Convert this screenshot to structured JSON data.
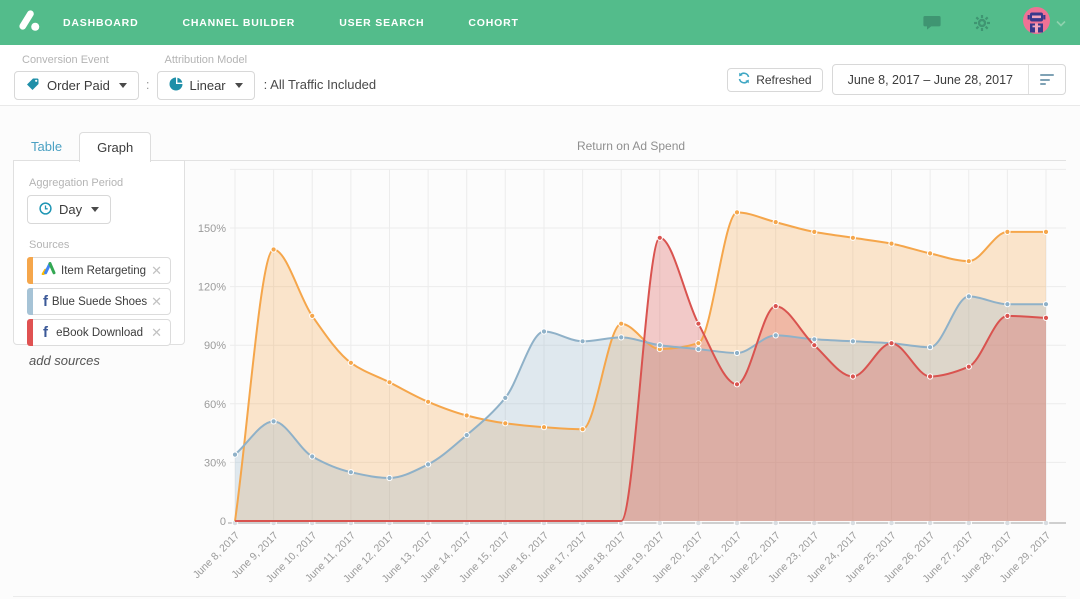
{
  "header": {
    "nav": [
      {
        "label": "DASHBOARD",
        "active": true
      },
      {
        "label": "CHANNEL BUILDER",
        "active": false
      },
      {
        "label": "USER SEARCH",
        "active": false
      },
      {
        "label": "COHORT",
        "active": false
      }
    ],
    "icons": {
      "chat": "speech-bubble",
      "settings": "gear",
      "account": "avatar-with-chevron"
    },
    "colors": {
      "background": "#53bc8b"
    }
  },
  "toolbar": {
    "conversion_event_label": "Conversion Event",
    "conversion_event_value": "Order Paid",
    "colon": ":",
    "attribution_model_label": "Attribution Model",
    "attribution_model_value": "Linear",
    "traffic_note": ": All Traffic Included",
    "refreshed_label": "Refreshed",
    "date_range": "June 8, 2017 – June 28, 2017",
    "icons": {
      "conversion_event": "tag",
      "attribution_model": "pie-chart",
      "refresh": "circular-arrows",
      "date_filter": "filter-lines"
    }
  },
  "tabs": [
    {
      "label": "Table",
      "active": false
    },
    {
      "label": "Graph",
      "active": true
    }
  ],
  "panel": {
    "aggregation_label": "Aggregation Period",
    "aggregation_value": "Day",
    "aggregation_icon": "clock",
    "sources_label": "Sources",
    "sources": [
      {
        "name": "Item Retargeting",
        "color": "#f5a64b",
        "icon": "adwords"
      },
      {
        "name": "Blue Suede Shoes",
        "color": "#a6c3d6",
        "icon": "facebook"
      },
      {
        "name": "eBook Download",
        "color": "#e05252",
        "icon": "facebook"
      }
    ],
    "add_sources_label": "add sources"
  },
  "chart_data": {
    "type": "area",
    "title": "Return on Ad Spend",
    "x": [
      "June 8, 2017",
      "June 9, 2017",
      "June 10, 2017",
      "June 11, 2017",
      "June 12, 2017",
      "June 13, 2017",
      "June 14, 2017",
      "June 15, 2017",
      "June 16, 2017",
      "June 17, 2017",
      "June 18, 2017",
      "June 19, 2017",
      "June 20, 2017",
      "June 21, 2017",
      "June 22, 2017",
      "June 23, 2017",
      "June 24, 2017",
      "June 25, 2017",
      "June 26, 2017",
      "June 27, 2017",
      "June 28, 2017",
      "June 29, 2017"
    ],
    "y_ticks": [
      "0",
      "30%",
      "60%",
      "90%",
      "120%",
      "150%"
    ],
    "ylim": [
      0,
      180
    ],
    "unit": "percent",
    "grid": true,
    "legend_position": "none",
    "series": [
      {
        "name": "Item Retargeting",
        "color": "#f5a64b",
        "values": [
          0,
          139,
          105,
          81,
          71,
          61,
          54,
          50,
          48,
          47,
          101,
          88,
          91,
          158,
          153,
          148,
          145,
          142,
          137,
          133,
          148,
          148
        ]
      },
      {
        "name": "Blue Suede Shoes",
        "color": "#8fb1c8",
        "values": [
          34,
          51,
          33,
          25,
          22,
          29,
          44,
          63,
          97,
          92,
          94,
          90,
          88,
          86,
          95,
          93,
          92,
          91,
          89,
          115,
          111,
          111
        ]
      },
      {
        "name": "eBook Download",
        "color": "#d9534f",
        "values": [
          0,
          0,
          0,
          0,
          0,
          0,
          0,
          0,
          0,
          0,
          0,
          145,
          101,
          70,
          110,
          90,
          74,
          91,
          74,
          79,
          105,
          104
        ]
      }
    ]
  }
}
